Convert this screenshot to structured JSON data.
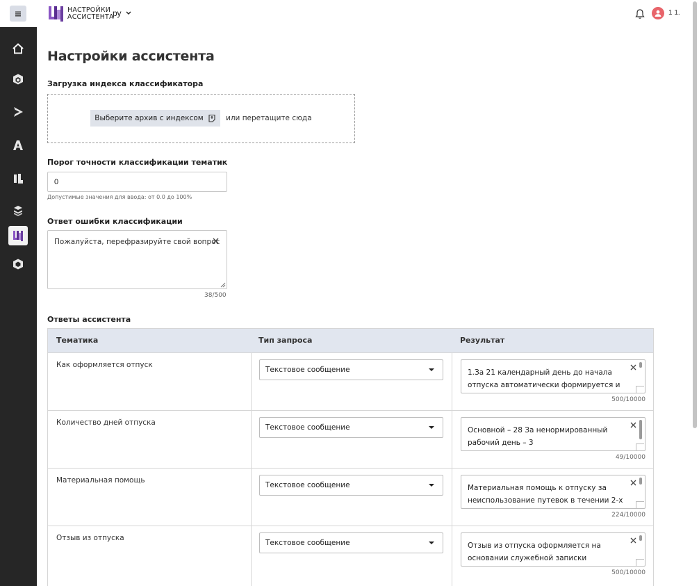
{
  "header": {
    "logo_line1": "НАСТРОЙКИ",
    "logo_line2": "АССИСТЕНТА",
    "language": "ру",
    "user_name": "1 1."
  },
  "sidebar": {
    "items": [
      {
        "icon": "home-icon"
      },
      {
        "icon": "package-icon"
      },
      {
        "icon": "play-icon"
      },
      {
        "icon": "assistant-a-icon"
      },
      {
        "icon": "document-icon"
      },
      {
        "icon": "layers-icon"
      },
      {
        "icon": "assistant-settings-icon",
        "active": true
      },
      {
        "icon": "box-icon"
      }
    ]
  },
  "page": {
    "title": "Настройки ассистента",
    "index_upload": {
      "label": "Загрузка индекса классификатора",
      "button": "Выберите архив с индексом",
      "drop_hint": "или перетащите сюда"
    },
    "threshold": {
      "label": "Порог точности классификации тематик",
      "value": "0",
      "hint": "Допустимые значения для ввода: от 0.0 до 100%"
    },
    "error_answer": {
      "label": "Ответ ошибки классификации",
      "value": "Пожалуйста, перефразируйте свой вопрос",
      "counter": "38/500"
    },
    "answers": {
      "label": "Ответы ассистента",
      "columns": [
        "Тематика",
        "Тип запроса",
        "Результат"
      ],
      "rows": [
        {
          "topic": "Как оформляется отпуск",
          "type": "Текстовое сообщение",
          "result": "1.За 21 календарный день до начала отпуска автоматически формируется и",
          "counter": "500/10000"
        },
        {
          "topic": "Количество дней отпуска",
          "type": "Текстовое сообщение",
          "result": "Основной – 28 За ненормированный рабочий день – 3",
          "counter": "49/10000"
        },
        {
          "topic": "Материальная помощь",
          "type": "Текстовое сообщение",
          "result": "Материальная помощь к отпуску за неиспользование путевок в течении 2-х",
          "counter": "224/10000"
        },
        {
          "topic": "Отзыв из отпуска",
          "type": "Текстовое сообщение",
          "result": "Отзыв из отпуска оформляется на основании служебной записки",
          "counter": "500/10000"
        }
      ]
    }
  },
  "colors": {
    "sidebar_bg": "#262626",
    "table_header_bg": "#e1e6ef",
    "accent_purple": "#6b3fa0",
    "avatar_red": "#e8646a"
  }
}
